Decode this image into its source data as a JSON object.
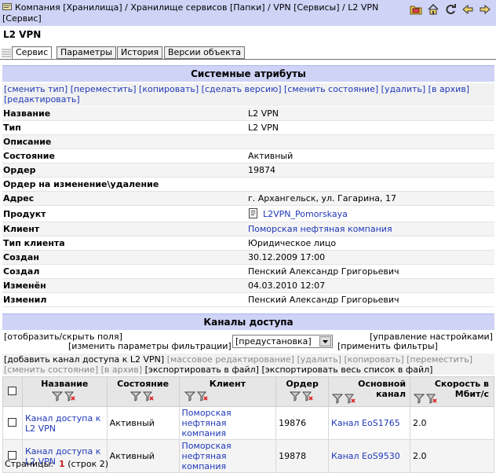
{
  "breadcrumb": "Компания [Хранилища] / Хранилище сервисов [Папки] / VPN [Сервисы] / L2 VPN [Сервис]",
  "object_title": "L2 VPN",
  "tabs": [
    "Сервис",
    "Параметры",
    "История",
    "Версии объекта"
  ],
  "system_section": {
    "title": "Системные атрибуты",
    "actions": [
      "[сменить тип]",
      "[переместить]",
      "[копировать]",
      "[сделать версию]",
      "[сменить состояние]",
      "[удалить]",
      "[в архив]",
      "[редактировать]"
    ]
  },
  "attributes": [
    {
      "label": "Название",
      "value": "L2 VPN"
    },
    {
      "label": "Тип",
      "value": "L2 VPN"
    },
    {
      "label": "Описание",
      "value": ""
    },
    {
      "label": "Состояние",
      "value": "Активный"
    },
    {
      "label": "Ордер",
      "value": "19874"
    },
    {
      "label": "Ордер на изменение\\удаление",
      "value": ""
    },
    {
      "label": "Адрес",
      "value": "г. Архангельск, ул. Гагарина, 17"
    },
    {
      "label": "Продукт",
      "value": "L2VPN_Pomorskaya"
    },
    {
      "label": "Клиент",
      "value": "Поморская нефтяная компания"
    },
    {
      "label": "Тип клиента",
      "value": "Юридическое лицо"
    },
    {
      "label": "Создан",
      "value": "30.12.2009 17:00"
    },
    {
      "label": "Создал",
      "value": "Пенский Александр Григорьевич"
    },
    {
      "label": "Изменён",
      "value": "04.03.2010 12:07"
    },
    {
      "label": "Изменил",
      "value": "Пенский Александр Григорьевич"
    }
  ],
  "channels_section": {
    "title": "Каналы доступа",
    "toggle_fields": "[отобразить/скрыть поля]",
    "manage_settings": "[управление настройками]",
    "change_filter": "[изменить параметры фильтрации]",
    "preset_value": "[предустановка]",
    "apply_filters": "[применить фильтры]",
    "actions": [
      {
        "label": "[добавить канал доступа к L2 VPN]",
        "enabled": true
      },
      {
        "label": "[массовое редактирование]",
        "enabled": false
      },
      {
        "label": "[удалить]",
        "enabled": false
      },
      {
        "label": "[копировать]",
        "enabled": false
      },
      {
        "label": "[переместить]",
        "enabled": false
      },
      {
        "label": "[сменить состояние]",
        "enabled": false
      },
      {
        "label": "[в архив]",
        "enabled": false
      },
      {
        "label": "[экспортировать в файл]",
        "enabled": true
      },
      {
        "label": "[экспортировать весь список в файл]",
        "enabled": true
      }
    ],
    "columns": [
      "Название",
      "Состояние",
      "Клиент",
      "Ордер",
      "Основной канал",
      "Скорость в Мбит/с"
    ],
    "rows": [
      {
        "name": "Канал доступа к L2 VPN",
        "state": "Активный",
        "client": "Поморская нефтяная компания",
        "order": "19876",
        "channel": "Канал EoS1765",
        "speed": "2.0"
      },
      {
        "name": "Канал доступа к L2 VPN",
        "state": "Активный",
        "client": "Поморская нефтяная компания",
        "order": "19878",
        "channel": "Канал EoS9530",
        "speed": "2.0"
      }
    ]
  },
  "pager": {
    "label": "Страницы:",
    "current": "1",
    "count_text": "(строк 2)"
  },
  "colors": {
    "header_bg": "#cfd3f6",
    "link": "#1f38b8",
    "disabled": "#8a8a8a",
    "current_page": "#c41f1f"
  }
}
